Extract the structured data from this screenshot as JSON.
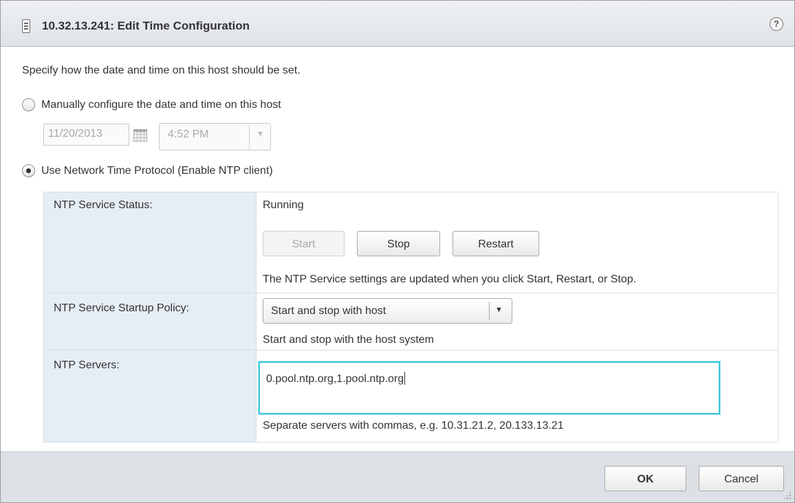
{
  "dialog": {
    "title": "10.32.13.241: Edit Time Configuration",
    "help_icon_glyph": "?",
    "intro": "Specify how the date and time on this host should be set."
  },
  "manual": {
    "label": "Manually configure the date and time on this host",
    "selected": false,
    "date_value": "11/20/2013",
    "time_value": "4:52 PM"
  },
  "ntp": {
    "option_label": "Use Network Time Protocol (Enable NTP client)",
    "selected": true,
    "status_label": "NTP Service Status:",
    "status_value": "Running",
    "start_label": "Start",
    "stop_label": "Stop",
    "restart_label": "Restart",
    "settings_note": "The NTP Service settings are updated when you click Start, Restart, or Stop.",
    "policy_label": "NTP Service Startup Policy:",
    "policy_value": "Start and stop with host",
    "policy_description": "Start and stop with the host system",
    "servers_label": "NTP Servers:",
    "servers_value": "0.pool.ntp.org,1.pool.ntp.org",
    "servers_hint": "Separate servers with commas, e.g. 10.31.21.2, 20.133.13.21"
  },
  "footer": {
    "ok_label": "OK",
    "cancel_label": "Cancel"
  },
  "icons": {
    "title": "host-server-icon",
    "help": "help-icon",
    "calendar": "calendar-icon",
    "dropdown": "chevron-down-icon",
    "resize": "resize-grip-icon"
  },
  "colors": {
    "titlebar": "#e3e7eb",
    "label_column": "#e5edf5",
    "focus_border": "#3cc6dc",
    "footer": "#dce1e6"
  }
}
